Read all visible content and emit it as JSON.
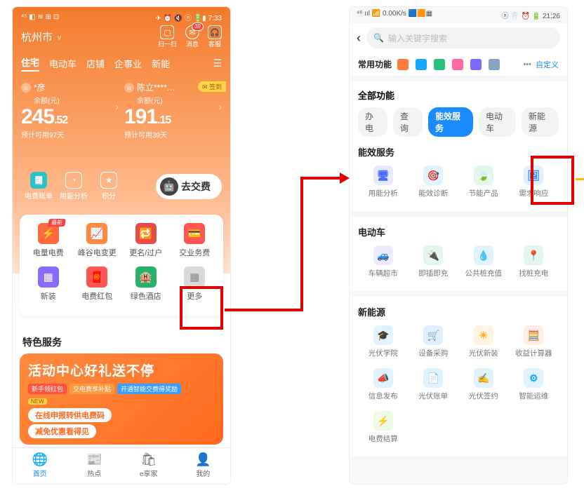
{
  "left": {
    "status_left": "⁴⁶ ◧ ≋ ⊞ ⊡",
    "status_right": "✈ ⏰ 🔇 ⓝ 🔋▮ 7:33",
    "city": "杭州市",
    "top_icons": {
      "scan": "扫一扫",
      "msg": "消息",
      "msg_badge": "39",
      "cs": "客服"
    },
    "tabs": [
      "住宅",
      "电动车",
      "店铺",
      "企事业",
      "新能"
    ],
    "accounts": [
      {
        "name": "*彦",
        "bal_label": "余额(元)",
        "int": "245",
        "cents": ".52",
        "days": "预计可用97天"
      },
      {
        "name": "陈立****…",
        "bal_label": "余额(元)",
        "int": "191",
        "cents": ".15",
        "days": "预计可用39天",
        "signin": "✉ 签到"
      }
    ],
    "mid": [
      "电费账单",
      "用能分析",
      "积分"
    ],
    "pay": "去交费",
    "grid": [
      {
        "t": "电量电费",
        "c": "ic-red",
        "g": "⚡",
        "tag": "最新"
      },
      {
        "t": "峰谷电变更",
        "c": "ic-org",
        "g": "📈"
      },
      {
        "t": "更名/过户",
        "c": "ic-red2",
        "g": "🔁"
      },
      {
        "t": "交业务费",
        "c": "ic-red3",
        "g": "💳"
      },
      {
        "t": "新装",
        "c": "ic-pur",
        "g": "▦"
      },
      {
        "t": "电费红包",
        "c": "ic-red3",
        "g": "🧧"
      },
      {
        "t": "绿色酒店",
        "c": "ic-grn",
        "g": "🏨"
      },
      {
        "t": "更多",
        "c": "ic-gray",
        "g": "▦"
      }
    ],
    "section": "特色服务",
    "promo": {
      "title": "活动中心好礼送不停",
      "tags": [
        "新手领红包",
        "交电费享补贴",
        "开通智能交费得奖励"
      ],
      "new": "NEW",
      "line1": "在线申报转供电费码",
      "line2": "减免优惠看得见"
    },
    "nav": [
      "首页",
      "热点",
      "e享家",
      "我的"
    ]
  },
  "right": {
    "status_left": "⁴⁶ ııl 📶 0.00K/s 🟦🟧▦",
    "status_right": "ⓝ 🦷 ⏰ 🔋 21:26",
    "search_ph": "输入关键字搜索",
    "fav_label": "常用功能",
    "fav_more": "•••",
    "fav_cust": "自定义",
    "all_label": "全部功能",
    "all_tabs": [
      "办电",
      "查询",
      "能效服务",
      "电动车",
      "新能源"
    ],
    "secs": [
      {
        "title": "能效服务",
        "items": [
          {
            "t": "用能分析",
            "c": "#4a6bff",
            "g": "🖥"
          },
          {
            "t": "能效诊断",
            "c": "#1aa6ff",
            "g": "🎯"
          },
          {
            "t": "节能产品",
            "c": "#2ac27a",
            "g": "🍃"
          },
          {
            "t": "需求响应",
            "c": "#1a8cff",
            "g": "🖼"
          }
        ]
      },
      {
        "title": "电动车",
        "items": [
          {
            "t": "车辆超市",
            "c": "#7a6bff",
            "g": "🚙"
          },
          {
            "t": "即插即充",
            "c": "#2ac27a",
            "g": "🔌"
          },
          {
            "t": "公共桩充值",
            "c": "#1aa6ff",
            "g": "💧"
          },
          {
            "t": "找桩充电",
            "c": "#2ac27a",
            "g": "📍"
          }
        ]
      },
      {
        "title": "新能源",
        "items": [
          {
            "t": "光伏学院",
            "c": "#1aa6ff",
            "g": "🎓"
          },
          {
            "t": "设备采购",
            "c": "#1a8cff",
            "g": "🛒"
          },
          {
            "t": "光伏新装",
            "c": "#ffb020",
            "g": "☀"
          },
          {
            "t": "收益计算器",
            "c": "#ff7a3d",
            "g": "🧮"
          },
          {
            "t": "信息发布",
            "c": "#1aa6ff",
            "g": "📣"
          },
          {
            "t": "光伏账单",
            "c": "#1aa6ff",
            "g": "📄"
          },
          {
            "t": "光伏签约",
            "c": "#1aa6ff",
            "g": "✍"
          },
          {
            "t": "智能运维",
            "c": "#1aa6ff",
            "g": "⚙"
          },
          {
            "t": "电费结算",
            "c": "#7ad45a",
            "g": "⚡"
          }
        ]
      }
    ]
  }
}
